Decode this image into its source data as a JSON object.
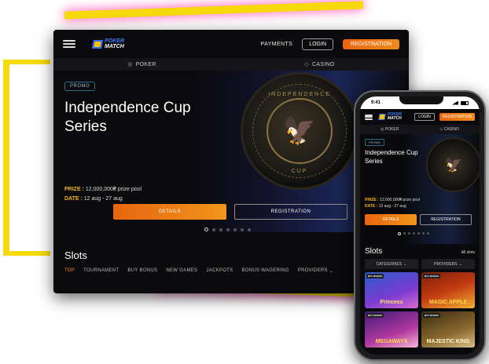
{
  "colors": {
    "accent": "#f08a1c",
    "highlight": "#f3b222",
    "glow": "#f5d90a",
    "background": "#0b0b0e"
  },
  "brand": {
    "line1": "POKER",
    "line2": "MATCH"
  },
  "desktop": {
    "header": {
      "payments": "PAYMENTS",
      "login": "LOGIN",
      "registration": "REGISTRATION"
    },
    "subnav": {
      "poker": "POKER",
      "casino": "CASINO"
    },
    "hero": {
      "badge": "PROMO",
      "title": "Independence Cup Series",
      "chip_text_top": "INDEPENDENCE",
      "chip_text_bottom": "CUP",
      "prize_label": "PRIZE :",
      "prize_value": "12,000,000₴ prize pool",
      "date_label": "DATE :",
      "date_value": "12 aug - 27 aug",
      "details_button": "DETAILS",
      "registration_button": "REGISTRATION",
      "slide_count": 7,
      "active_slide": 1
    },
    "slots": {
      "title": "Slots",
      "categories": [
        "TOP",
        "TOURNAMENT",
        "BUY BONUS",
        "NEW GAMES",
        "JACKPOTS",
        "BONUS WAGERING",
        "PROVIDERS"
      ],
      "active_category": "TOP"
    }
  },
  "phone": {
    "status": {
      "time": "9:41"
    },
    "header": {
      "login": "LOGIN",
      "registration": "REGISTRATION"
    },
    "subnav": {
      "poker": "POKER",
      "casino": "CASINO"
    },
    "hero": {
      "badge": "PROMO",
      "title": "Independence Cup Series",
      "prize_label": "PRIZE :",
      "prize_value": "12,000,000₴ prize pool",
      "date_label": "DATE :",
      "date_value": "12 aug - 27 aug",
      "details_button": "DETAILS",
      "registration_button": "REGISTRATION"
    },
    "slots": {
      "title": "Slots",
      "all": "All slots",
      "filter_categories": "CATEGORIES",
      "filter_providers": "PROVIDERS",
      "games": [
        {
          "name": "Princess",
          "tag": "BUY BONUS"
        },
        {
          "name": "MAGIC APPLE",
          "tag": "BUY BONUS"
        },
        {
          "name": "MEGAWAYS",
          "tag": "BUY BONUS"
        },
        {
          "name": "MAJESTIC KING",
          "tag": "BUY BONUS"
        }
      ]
    }
  }
}
